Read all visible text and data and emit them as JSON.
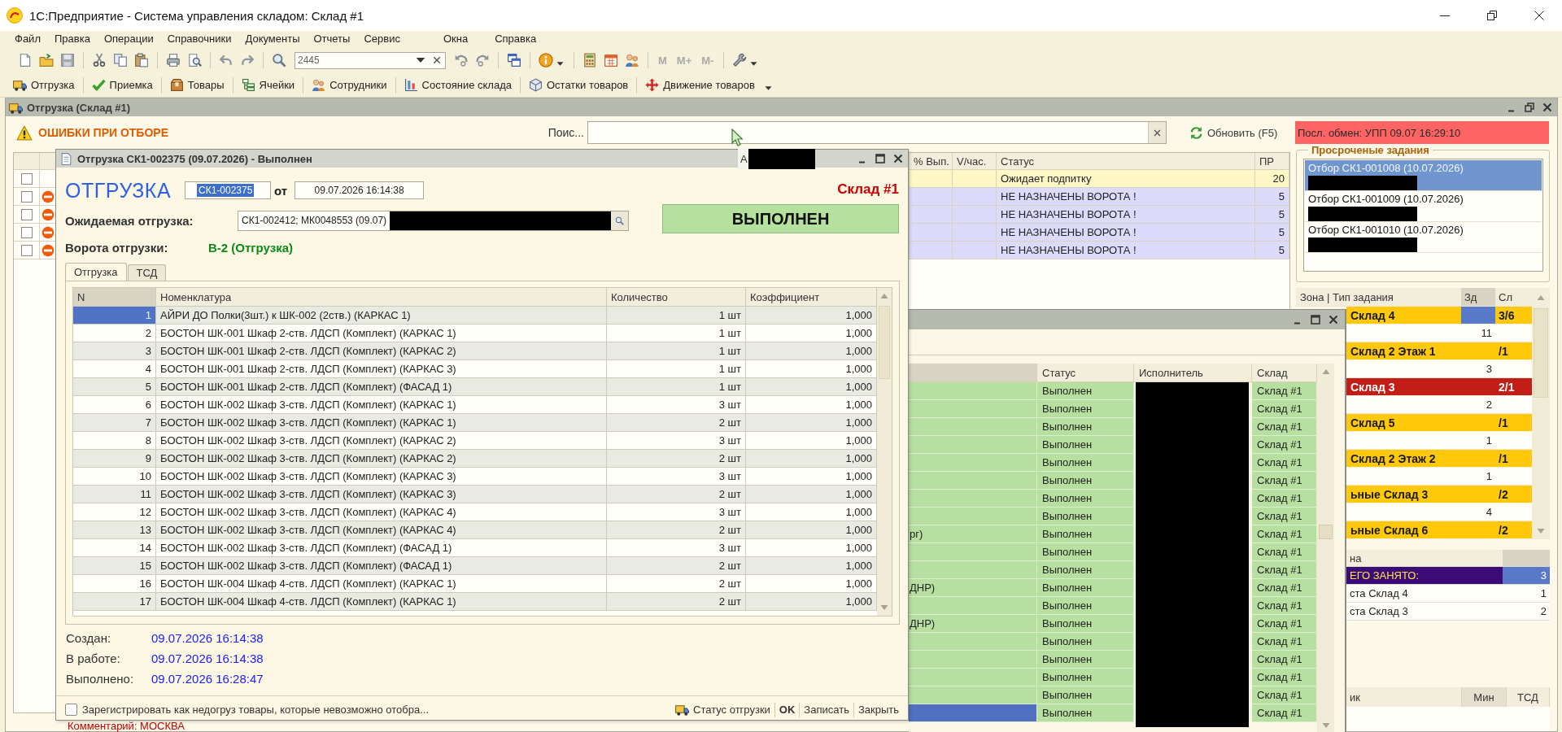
{
  "app": {
    "title": "1С:Предприятие - Система управления складом: Склад #1"
  },
  "menu": [
    "Файл",
    "Правка",
    "Операции",
    "Справочники",
    "Документы",
    "Отчеты",
    "Сервис",
    "Окна",
    "Справка"
  ],
  "toolbar": {
    "search_value": "2445",
    "memory": [
      {
        "label": "M",
        "disabled": true
      },
      {
        "label": "M+",
        "disabled": true
      },
      {
        "label": "M-",
        "disabled": true
      }
    ]
  },
  "nav": [
    "Отгрузка",
    "Приемка",
    "Товары",
    "Ячейки",
    "Сотрудники",
    "Состояние склада",
    "Остатки товаров",
    "Движение товаров"
  ],
  "main_window": {
    "title": "Отгрузка (Склад #1)",
    "alert": "ОШИБКИ ПРИ ОТБОРЕ",
    "search_label": "Поис...",
    "refresh": "Обновить (F5)",
    "exchange": "Посл. обмен: УПП 09.07 16:29:10",
    "comment": "Комментарий: МОСКВА"
  },
  "tasks_grid": {
    "columns": [
      "% Вып.",
      "V/час.",
      "Статус",
      "ПР"
    ],
    "header_fragment": {
      "text": "А",
      "redacted": true
    },
    "rows": [
      {
        "checked": false,
        "error": false,
        "color": "#fff7c6",
        "status": "Ожидает подпитку",
        "pr": "20"
      },
      {
        "checked": false,
        "error": true,
        "color": "#dcdbfb",
        "status": "НЕ НАЗНАЧЕНЫ ВОРОТА !",
        "pr": "5"
      },
      {
        "checked": false,
        "error": true,
        "color": "#dcdbfb",
        "status": "НЕ НАЗНАЧЕНЫ ВОРОТА !",
        "pr": "5"
      },
      {
        "checked": false,
        "error": true,
        "color": "#dcdbfb",
        "status": "НЕ НАЗНАЧЕНЫ ВОРОТА !",
        "pr": "5"
      },
      {
        "checked": false,
        "error": true,
        "color": "#dcdbfb",
        "status": "НЕ НАЗНАЧЕНЫ ВОРОТА !",
        "pr": "5"
      }
    ]
  },
  "overdue": {
    "title": "Просроченые задания",
    "items": [
      {
        "label": "Отбор СК1-001008 (10.07.2026)",
        "selected": true,
        "redacted": true
      },
      {
        "label": "Отбор СК1-001009 (10.07.2026)",
        "selected": false,
        "redacted": true
      },
      {
        "label": "Отбор СК1-001010 (10.07.2026)",
        "selected": false,
        "redacted": true
      }
    ]
  },
  "zones": {
    "columns": [
      "Зона | Тип задания",
      "Зд",
      "Сл"
    ],
    "rows": [
      {
        "kind": "group",
        "name": "Склад 4",
        "sl": "3/6",
        "color": "#ffc90a",
        "selected": true
      },
      {
        "kind": "detail",
        "zd": "11",
        "selected": false
      },
      {
        "kind": "group",
        "name": "Склад 2 Этаж 1",
        "sl": "/1",
        "color": "#ffc90a",
        "selected": false
      },
      {
        "kind": "detail",
        "zd": "3",
        "selected": false
      },
      {
        "kind": "group",
        "name": "Склад 3",
        "sl": "2/1",
        "color": "#c21d16",
        "selected": false
      },
      {
        "kind": "detail",
        "zd": "2",
        "selected": false
      },
      {
        "kind": "group",
        "name": "Склад 5",
        "sl": "/1",
        "color": "#ffc90a",
        "selected": false
      },
      {
        "kind": "detail",
        "zd": "1",
        "selected": false
      },
      {
        "kind": "group",
        "name": "Склад 2 Этаж 2",
        "sl": "/1",
        "color": "#ffc90a",
        "selected": false
      },
      {
        "kind": "detail",
        "zd": "1",
        "selected": false
      },
      {
        "kind": "group",
        "name": "ьные Склад 3",
        "sl": "/2",
        "color": "#ffc90a",
        "selected": false
      },
      {
        "kind": "detail",
        "zd": "4",
        "selected": false
      },
      {
        "kind": "group",
        "name": "ьные Склад 6",
        "sl": "/2",
        "color": "#ffc90a",
        "selected": false
      }
    ]
  },
  "occupancy": {
    "columns": [
      "на"
    ],
    "rows": [
      {
        "kind": "total",
        "label": "ЕГО ЗАНЯТО:",
        "value": "3"
      },
      {
        "kind": "item",
        "label": "ста Склад 4",
        "value": "1"
      },
      {
        "kind": "item",
        "label": "ста Склад 3",
        "value": "2"
      }
    ]
  },
  "staff": {
    "columns": [
      "ик",
      "Мин",
      "ТСД"
    ]
  },
  "picking_window": {
    "columns": [
      "Статус",
      "Исполнитель",
      "Склад"
    ],
    "executor_redacted": true,
    "rows": [
      {
        "status": "Выполнен",
        "warehouse": "Склад #1",
        "selected": false
      },
      {
        "status": "Выполнен",
        "warehouse": "Склад #1",
        "selected": false
      },
      {
        "status": "Выполнен",
        "warehouse": "Склад #1",
        "selected": false
      },
      {
        "status": "Выполнен",
        "warehouse": "Склад #1",
        "selected": false
      },
      {
        "status": "Выполнен",
        "warehouse": "Склад #1",
        "selected": false
      },
      {
        "status": "Выполнен",
        "warehouse": "Склад #1",
        "selected": false
      },
      {
        "status": "Выполнен",
        "warehouse": "Склад #1",
        "selected": false
      },
      {
        "status": "Выполнен",
        "warehouse": "Склад #1",
        "selected": false
      },
      {
        "column_1": "рг)",
        "status": "Выполнен",
        "warehouse": "Склад #1",
        "selected": false
      },
      {
        "status": "Выполнен",
        "warehouse": "Склад #1",
        "selected": false
      },
      {
        "status": "Выполнен",
        "warehouse": "Склад #1",
        "selected": false
      },
      {
        "column_1": "ДНР)",
        "status": "Выполнен",
        "warehouse": "Склад #1",
        "selected": false
      },
      {
        "status": "Выполнен",
        "warehouse": "Склад #1",
        "selected": false
      },
      {
        "column_1": "ДНР)",
        "status": "Выполнен",
        "warehouse": "Склад #1",
        "selected": false
      },
      {
        "status": "Выполнен",
        "warehouse": "Склад #1",
        "selected": false
      },
      {
        "status": "Выполнен",
        "warehouse": "Склад #1",
        "selected": false
      },
      {
        "status": "Выполнен",
        "warehouse": "Склад #1",
        "selected": false
      },
      {
        "status": "Выполнен",
        "warehouse": "Склад #1",
        "selected": false
      },
      {
        "status": "Выполнен",
        "warehouse": "Склад #1",
        "selected": true
      }
    ]
  },
  "dialog": {
    "title": "Отгрузка СК1-002375 (09.07.2026) - Выполнен",
    "heading": "ОТГРУЗКА",
    "number": "СК1-002375",
    "number_selected": true,
    "from_label": "от",
    "date": "09.07.2026 16:14:38",
    "warehouse": "Склад #1",
    "status": "ВЫПОЛНЕН",
    "expected": {
      "label": "Ожидаемая отгрузка:",
      "value": "СК1-002412; МК0048553 (09.07)",
      "redacted": true
    },
    "gate": {
      "label": "Ворота отгрузки:",
      "value": "В-2 (Отгрузка)"
    },
    "tabs": [
      {
        "label": "Отгрузка",
        "selected": true
      },
      {
        "label": "ТСД",
        "selected": false
      }
    ],
    "table": {
      "columns": [
        "N",
        "Номенклатура",
        "Количество",
        "Коэффициент"
      ],
      "rows": [
        {
          "n": "1",
          "name": "АЙРИ ДО Полки(3шт.) к ШК-002 (2ств.) (КАРКАС 1)",
          "qty": "1 шт",
          "coef": "1,000",
          "selected": true
        },
        {
          "n": "2",
          "name": "БОСТОН ШК-001 Шкаф 2-ств. ЛДСП (Комплект) (КАРКАС 1)",
          "qty": "1 шт",
          "coef": "1,000",
          "selected": false
        },
        {
          "n": "3",
          "name": "БОСТОН ШК-001 Шкаф 2-ств. ЛДСП (Комплект) (КАРКАС 2)",
          "qty": "1 шт",
          "coef": "1,000",
          "selected": false
        },
        {
          "n": "4",
          "name": "БОСТОН ШК-001 Шкаф 2-ств. ЛДСП (Комплект) (КАРКАС 3)",
          "qty": "1 шт",
          "coef": "1,000",
          "selected": false
        },
        {
          "n": "5",
          "name": "БОСТОН ШК-001 Шкаф 2-ств. ЛДСП (Комплект) (ФАСАД 1)",
          "qty": "1 шт",
          "coef": "1,000",
          "selected": false
        },
        {
          "n": "6",
          "name": "БОСТОН ШК-002 Шкаф 3-ств. ЛДСП (Комплект) (КАРКАС 1)",
          "qty": "3 шт",
          "coef": "1,000",
          "selected": false
        },
        {
          "n": "7",
          "name": "БОСТОН ШК-002 Шкаф 3-ств. ЛДСП (Комплект) (КАРКАС 1)",
          "qty": "2 шт",
          "coef": "1,000",
          "selected": false
        },
        {
          "n": "8",
          "name": "БОСТОН ШК-002 Шкаф 3-ств. ЛДСП (Комплект) (КАРКАС 2)",
          "qty": "3 шт",
          "coef": "1,000",
          "selected": false
        },
        {
          "n": "9",
          "name": "БОСТОН ШК-002 Шкаф 3-ств. ЛДСП (Комплект) (КАРКАС 2)",
          "qty": "2 шт",
          "coef": "1,000",
          "selected": false
        },
        {
          "n": "10",
          "name": "БОСТОН ШК-002 Шкаф 3-ств. ЛДСП (Комплект) (КАРКАС 3)",
          "qty": "3 шт",
          "coef": "1,000",
          "selected": false
        },
        {
          "n": "11",
          "name": "БОСТОН ШК-002 Шкаф 3-ств. ЛДСП (Комплект) (КАРКАС 3)",
          "qty": "2 шт",
          "coef": "1,000",
          "selected": false
        },
        {
          "n": "12",
          "name": "БОСТОН ШК-002 Шкаф 3-ств. ЛДСП (Комплект) (КАРКАС 4)",
          "qty": "3 шт",
          "coef": "1,000",
          "selected": false
        },
        {
          "n": "13",
          "name": "БОСТОН ШК-002 Шкаф 3-ств. ЛДСП (Комплект) (КАРКАС 4)",
          "qty": "2 шт",
          "coef": "1,000",
          "selected": false
        },
        {
          "n": "14",
          "name": "БОСТОН ШК-002 Шкаф 3-ств. ЛДСП (Комплект) (ФАСАД 1)",
          "qty": "3 шт",
          "coef": "1,000",
          "selected": false
        },
        {
          "n": "15",
          "name": "БОСТОН ШК-002 Шкаф 3-ств. ЛДСП (Комплект) (ФАСАД 1)",
          "qty": "2 шт",
          "coef": "1,000",
          "selected": false
        },
        {
          "n": "16",
          "name": "БОСТОН ШК-004 Шкаф 4-ств. ЛДСП (Комплект) (КАРКАС 1)",
          "qty": "2 шт",
          "coef": "1,000",
          "selected": false
        },
        {
          "n": "17",
          "name": "БОСТОН ШК-004 Шкаф 4-ств. ЛДСП (Комплект) (КАРКАС 1)",
          "qty": "2 шт",
          "coef": "1,000",
          "selected": false
        }
      ]
    },
    "times": [
      {
        "label": "Создан:",
        "value": "09.07.2026 16:14:38"
      },
      {
        "label": "В работе:",
        "value": "09.07.2026 16:14:38"
      },
      {
        "label": "Выполнено:",
        "value": "09.07.2026 16:28:47"
      }
    ],
    "footer": {
      "checkbox": {
        "label": "Зарегистрировать как недогруз товары, которые невозможно отобра...",
        "checked": false
      },
      "buttons": [
        {
          "label": "Статус отгрузки",
          "default": false
        },
        {
          "label": "OK",
          "default": true
        },
        {
          "label": "Записать",
          "default": false
        },
        {
          "label": "Закрыть",
          "default": false
        }
      ]
    }
  }
}
